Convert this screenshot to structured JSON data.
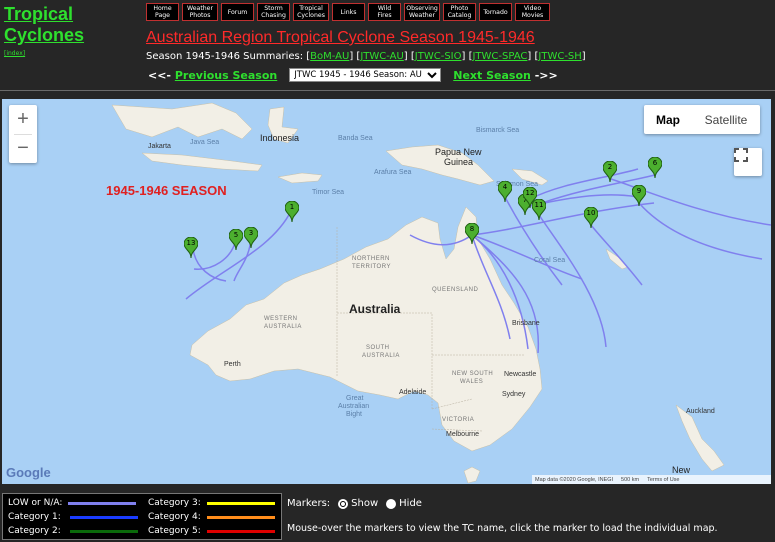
{
  "site": {
    "title_line1": "Tropical",
    "title_line2": "Cyclones",
    "index_link": "[index]"
  },
  "nav": [
    {
      "label": "Home\nPage"
    },
    {
      "label": "Weather\nPhotos"
    },
    {
      "label": "Forum"
    },
    {
      "label": "Storm\nChasing"
    },
    {
      "label": "Tropical\nCyclones"
    },
    {
      "label": "Links"
    },
    {
      "label": "Wild\nFires"
    },
    {
      "label": "Observing\nWeather"
    },
    {
      "label": "Photo\nCatalog"
    },
    {
      "label": "Tornado"
    },
    {
      "label": "Video\nMovies"
    }
  ],
  "page_title": "Australian Region Tropical Cyclone Season 1945-1946",
  "summaries": {
    "prefix": "Season 1945-1946 Summaries:",
    "links": [
      "BoM-AU",
      "JTWC-AU",
      "JTWC-SIO",
      "JTWC-SPAC",
      "JTWC-SH"
    ]
  },
  "season_nav": {
    "prev_arrow": "<<-",
    "prev_label": "Previous Season",
    "selected": "JTWC 1945 - 1946 Season: AU",
    "next_label": "Next Season",
    "next_arrow": "->>"
  },
  "map": {
    "season_label": "1945-1946 SEASON",
    "map_button": "Map",
    "satellite_button": "Satellite",
    "google": "Google",
    "attribution": "Map data ©2020 Google, INEGI",
    "scale": "500 km",
    "terms": "Terms of Use",
    "labels": {
      "indonesia": "Indonesia",
      "jakarta": "Jakarta",
      "java_sea": "Java Sea",
      "banda_sea": "Banda Sea",
      "bismarck_sea": "Bismarck Sea",
      "solomon_sea": "Solomon Sea",
      "png_1": "Papua New",
      "png_2": "Guinea",
      "arafura": "Arafura Sea",
      "timor": "Timor Sea",
      "coral": "Coral Sea",
      "australia": "Australia",
      "nt_1": "NORTHERN",
      "nt_2": "TERRITORY",
      "qld": "QUEENSLAND",
      "wa_1": "WESTERN",
      "wa_2": "AUSTRALIA",
      "sa_1": "SOUTH",
      "sa_2": "AUSTRALIA",
      "nsw_1": "NEW SOUTH",
      "nsw_2": "WALES",
      "vic": "VICTORIA",
      "perth": "Perth",
      "brisbane": "Brisbane",
      "newcastle": "Newcastle",
      "sydney": "Sydney",
      "adelaide": "Adelaide",
      "melbourne": "Melbourne",
      "gab_1": "Great",
      "gab_2": "Australian",
      "gab_3": "Bight",
      "auckland": "Auckland",
      "new": "New"
    },
    "markers": [
      "1",
      "2",
      "3",
      "4",
      "5",
      "6",
      "7",
      "8",
      "9",
      "10",
      "11",
      "12",
      "13"
    ]
  },
  "legend": {
    "low": "LOW or N/A:",
    "cat1": "Category 1:",
    "cat2": "Category 2:",
    "cat3": "Category 3:",
    "cat4": "Category 4:",
    "cat5": "Category 5:",
    "colors": {
      "low": "#8080ee",
      "cat1": "#1a3cff",
      "cat2": "#0a6a0a",
      "cat3": "#ffff00",
      "cat4": "#ff8c1a",
      "cat5": "#e00000"
    }
  },
  "markers_control": {
    "label": "Markers:",
    "show": "Show",
    "hide": "Hide",
    "selected": "Show"
  },
  "help_text": "Mouse-over the markers to view the TC name, click the marker to load the individual map."
}
